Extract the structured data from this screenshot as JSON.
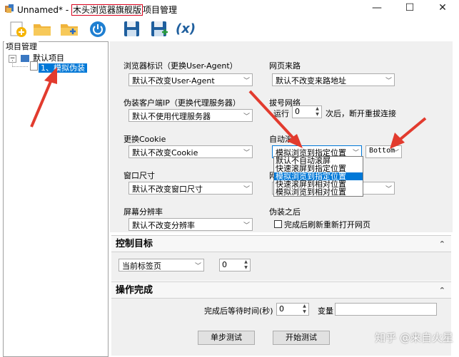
{
  "window": {
    "title_prefix": "Unnamed* - ",
    "title_highlight": "木头浏览器旗舰版",
    "title_suffix": "项目管理",
    "minimize": "—",
    "maximize": "☐",
    "close": "✕"
  },
  "toolbar": {
    "icons": [
      "new-project-icon",
      "open-folder-icon",
      "add-folder-icon",
      "power-icon",
      "save-icon",
      "save-as-icon",
      "variable-icon"
    ],
    "variable_label": "(x)"
  },
  "left_panel": {
    "title": "项目管理",
    "tree_root": "默认项目",
    "tree_child": "1、模拟伪装"
  },
  "settings": {
    "ua_label": "浏览器标识（更换User-Agent）",
    "ua_value": "默认不改变User-Agent",
    "ip_label": "伪装客户端IP（更换代理服务器）",
    "ip_value": "默认不使用代理服务器",
    "cookie_label": "更换Cookie",
    "cookie_value": "默认不改变Cookie",
    "window_label": "窗口尺寸",
    "window_value": "默认不改变窗口尺寸",
    "resolution_label": "屏幕分辨率",
    "resolution_value": "默认不改变分辨率",
    "referer_label": "网页来路",
    "referer_value": "默认不改变来路地址",
    "dial_label": "拔号网络",
    "dial_run": "运行",
    "dial_count": "0",
    "dial_suffix": "次后，断开重拔连接",
    "scroll_label": "自动滚",
    "scroll_value": "模拟浏览到指定位置",
    "scroll_position": "Bottom",
    "hidden_label": "网",
    "after_label": "伪装之后",
    "after_checkbox": "完成后刷新重新打开网页",
    "scroll_options": [
      "默认不自动滚屏",
      "快速滚屏到指定位置",
      "模拟浏览到指定位置",
      "快速滚屏到相对位置",
      "模拟浏览到相对位置"
    ],
    "scroll_selected_index": 2
  },
  "control_target": {
    "title": "控制目标",
    "tab_value": "当前标签页",
    "tab_index": "0"
  },
  "finish": {
    "title": "操作完成",
    "wait_label": "完成后等待时间(秒)",
    "wait_value": "0",
    "var_label": "变量",
    "var_value": "",
    "step_test": "单步测试",
    "start_test": "开始测试"
  },
  "watermark": "知乎 @来自火星",
  "colors": {
    "selection": "#0078d7",
    "annotation_red": "#e23b2e"
  }
}
